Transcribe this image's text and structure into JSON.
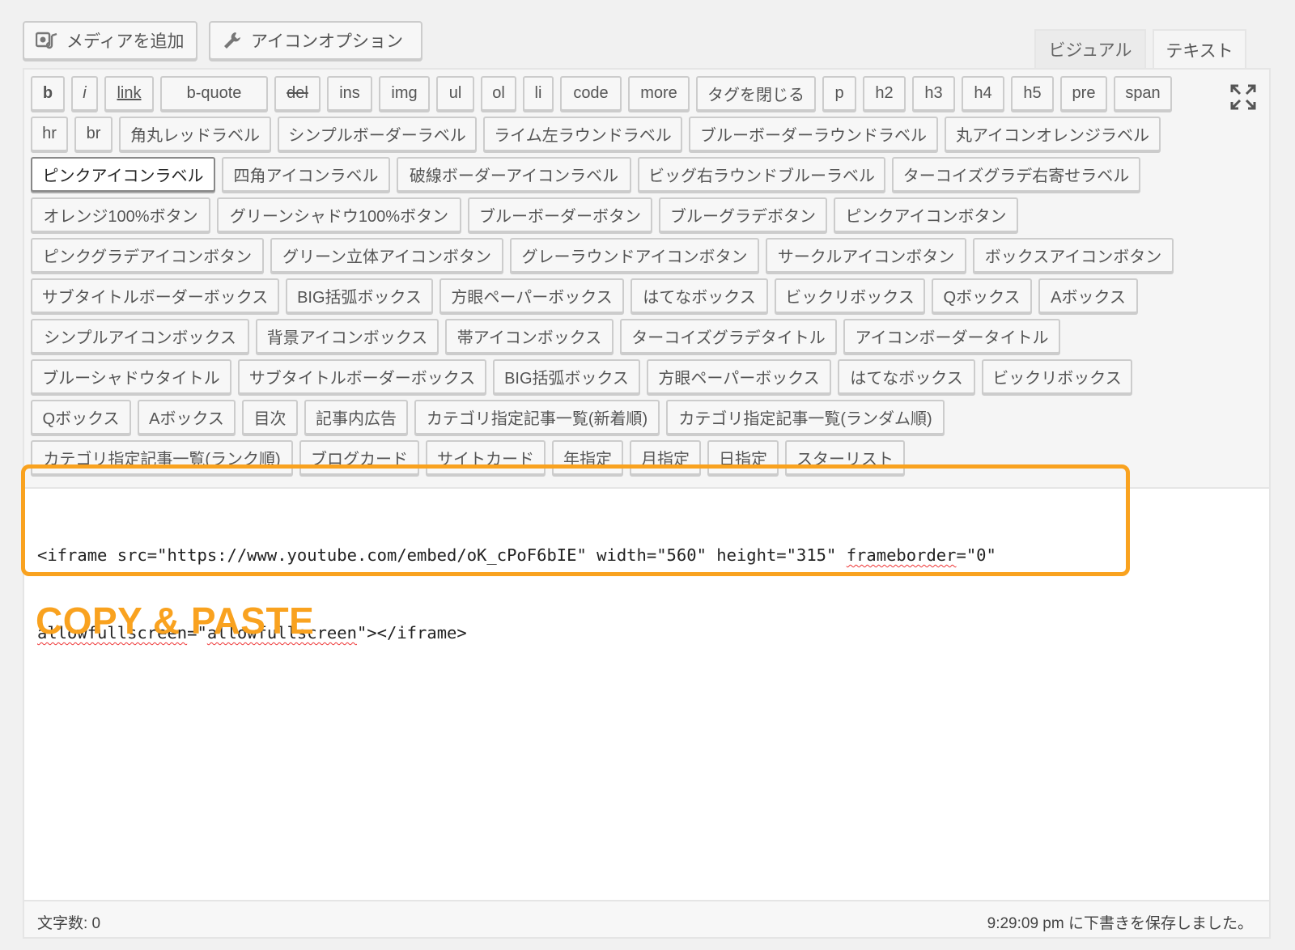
{
  "media_button": {
    "label": "メディアを追加",
    "icon": "media-icon"
  },
  "icon_option_button": {
    "label": "アイコンオプション",
    "icon": "wrench-icon"
  },
  "tabs": [
    {
      "label": "ビジュアル",
      "active": false
    },
    {
      "label": "テキスト",
      "active": true
    }
  ],
  "toolbar": {
    "buttons": [
      "b",
      "i",
      "link",
      "b-quote",
      "del",
      "ins",
      "img",
      "ul",
      "ol",
      "li",
      "code",
      "more",
      "タグを閉じる",
      "p",
      "h2",
      "h3",
      "h4",
      "h5",
      "pre",
      "span",
      "hr",
      "br",
      "角丸レッドラベル",
      "シンプルボーダーラベル",
      "ライム左ラウンドラベル",
      "ブルーボーダーラウンドラベル",
      "丸アイコンオレンジラベル",
      "ピンクアイコンラベル",
      "四角アイコンラベル",
      "破線ボーダーアイコンラベル",
      "ビッグ右ラウンドブルーラベル",
      "ターコイズグラデ右寄せラベル",
      "オレンジ100%ボタン",
      "グリーンシャドウ100%ボタン",
      "ブルーボーダーボタン",
      "ブルーグラデボタン",
      "ピンクアイコンボタン",
      "ピンクグラデアイコンボタン",
      "グリーン立体アイコンボタン",
      "グレーラウンドアイコンボタン",
      "サークルアイコンボタン",
      "ボックスアイコンボタン",
      "サブタイトルボーダーボックス",
      "BIG括弧ボックス",
      "方眼ペーパーボックス",
      "はてなボックス",
      "ビックリボックス",
      "Qボックス",
      "Aボックス",
      "シンプルアイコンボックス",
      "背景アイコンボックス",
      "帯アイコンボックス",
      "ターコイズグラデタイトル",
      "アイコンボーダータイトル",
      "ブルーシャドウタイトル",
      "サブタイトルボーダーボックス",
      "BIG括弧ボックス",
      "方眼ペーパーボックス",
      "はてなボックス",
      "ビックリボックス",
      "Qボックス",
      "Aボックス",
      "目次",
      "記事内広告",
      "カテゴリ指定記事一覧(新着順)",
      "カテゴリ指定記事一覧(ランダム順)",
      "カテゴリ指定記事一覧(ランク順)",
      "ブログカード",
      "サイトカード",
      "年指定",
      "月指定",
      "日指定",
      "スターリスト"
    ],
    "fullscreen_icon": "fullscreen-icon"
  },
  "editor": {
    "code_line1_a": "<iframe src=\"https://www.youtube.com/embed/oK_cPoF6bIE\" width=\"560\" height=\"315\" ",
    "code_line1_b": "frameborder",
    "code_line1_c": "=\"0\"",
    "code_line2_a": "allowfullscreen",
    "code_line2_b": "=\"",
    "code_line2_c": "allowfullscreen",
    "code_line2_d": "\"></iframe>"
  },
  "annotation": {
    "label": "COPY & PASTE",
    "color": "#f9a21f"
  },
  "status": {
    "word_count": "文字数: 0",
    "saved": "9:29:09 pm に下書きを保存しました。"
  }
}
